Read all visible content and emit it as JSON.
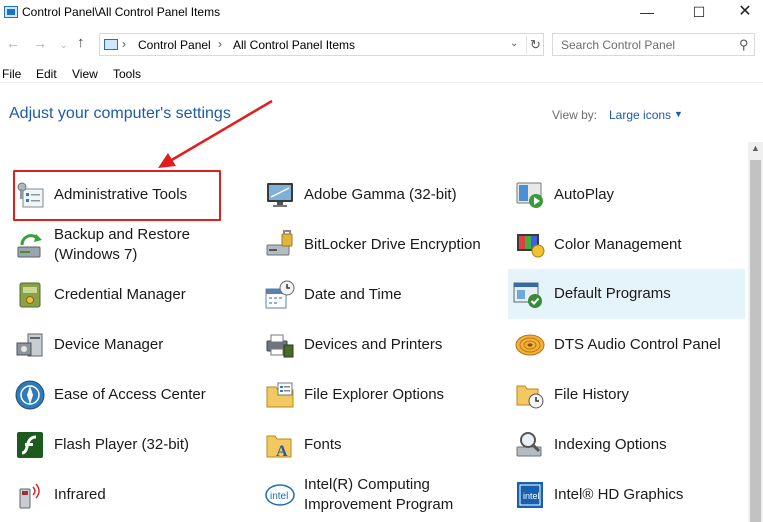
{
  "window": {
    "title": "Control Panel\\All Control Panel Items",
    "controls": {
      "minimize": "—",
      "maximize": "☐",
      "close": "✕"
    }
  },
  "navigation": {
    "back": "←",
    "forward": "→",
    "history": "⌄",
    "up": "↑",
    "breadcrumbs": [
      "Control Panel",
      "All Control Panel Items"
    ],
    "separator": "›",
    "dropdown": "⌄",
    "refresh": "↻",
    "search_placeholder": "Search Control Panel"
  },
  "menu": {
    "items": [
      "File",
      "Edit",
      "View",
      "Tools"
    ]
  },
  "header": {
    "title": "Adjust your computer's settings",
    "view_by_label": "View by:",
    "view_by_value": "Large icons",
    "view_by_caret": "▼"
  },
  "items": [
    {
      "label": "Administrative Tools",
      "icon": "administrative-tools-icon"
    },
    {
      "label": "Adobe Gamma (32-bit)",
      "icon": "adobe-gamma-icon"
    },
    {
      "label": "AutoPlay",
      "icon": "autoplay-icon"
    },
    {
      "label": "Backup and Restore (Windows 7)",
      "line1": "Backup and Restore",
      "line2": "(Windows 7)",
      "icon": "backup-restore-icon"
    },
    {
      "label": "BitLocker Drive Encryption",
      "icon": "bitlocker-icon"
    },
    {
      "label": "Color Management",
      "icon": "color-management-icon"
    },
    {
      "label": "Credential Manager",
      "icon": "credential-manager-icon"
    },
    {
      "label": "Date and Time",
      "icon": "date-time-icon"
    },
    {
      "label": "Default Programs",
      "icon": "default-programs-icon"
    },
    {
      "label": "Device Manager",
      "icon": "device-manager-icon"
    },
    {
      "label": "Devices and Printers",
      "icon": "devices-printers-icon"
    },
    {
      "label": "DTS Audio Control Panel",
      "icon": "dts-audio-icon"
    },
    {
      "label": "Ease of Access Center",
      "icon": "ease-of-access-icon"
    },
    {
      "label": "File Explorer Options",
      "icon": "file-explorer-options-icon"
    },
    {
      "label": "File History",
      "icon": "file-history-icon"
    },
    {
      "label": "Flash Player (32-bit)",
      "icon": "flash-player-icon"
    },
    {
      "label": "Fonts",
      "icon": "fonts-icon"
    },
    {
      "label": "Indexing Options",
      "icon": "indexing-options-icon"
    },
    {
      "label": "Infrared",
      "icon": "infrared-icon"
    },
    {
      "label": "Intel(R) Computing Improvement Program",
      "line1": "Intel(R) Computing",
      "line2": "Improvement Program",
      "icon": "intel-computing-icon"
    },
    {
      "label": "Intel® HD Graphics",
      "icon": "intel-hd-graphics-icon"
    }
  ],
  "colors": {
    "accent_text": "#1e5aa8",
    "highlight_bg": "#e5f3fb",
    "callout_red": "#e01e1e"
  }
}
